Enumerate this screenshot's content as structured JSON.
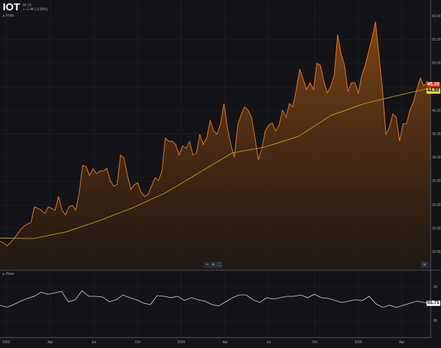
{
  "header": {
    "symbol": "IOT",
    "price": "45.10",
    "change": "-1.44 (-3.09%)",
    "plots_label": "Plots"
  },
  "lower_pane": {
    "plots_label": "Plots",
    "current_label": "51.71"
  },
  "controls": {
    "zoom_out": "−",
    "zoom_in": "+",
    "reset": "⛶",
    "scroll_forward": "»"
  },
  "colors": {
    "price": "#f07820",
    "ma": "#d8c020",
    "rsi": "#e0e0e0",
    "last_price_tag": "#c83020",
    "ma_tag": "#f0e020"
  },
  "chart_data": [
    {
      "type": "area",
      "title": "IOT",
      "ylim": [
        8,
        62
      ],
      "yticks": [
        "10.00",
        "15.00",
        "20.00",
        "25.00",
        "30.00",
        "35.00",
        "40.00",
        "45.00",
        "50.00",
        "55.00",
        "60.00"
      ],
      "last_price": "45.10",
      "ma_last": "44.80",
      "xticks": [
        "2023",
        "Apr",
        "Jul",
        "Oct",
        "2024",
        "Apr",
        "Jul",
        "Oct",
        "2025",
        "Apr"
      ],
      "price": [
        12.3,
        12.0,
        11.3,
        12.0,
        12.8,
        13.8,
        14.8,
        15.5,
        16.0,
        16.3,
        19.6,
        19.3,
        18.9,
        18.2,
        19.6,
        19.3,
        18.9,
        21.8,
        18.9,
        17.9,
        19.6,
        19.9,
        18.9,
        22.6,
        28.4,
        28.1,
        26.2,
        27.7,
        26.6,
        27.2,
        27.2,
        27.8,
        25.2,
        24.0,
        24.3,
        30.6,
        29.9,
        26.2,
        23.3,
        24.3,
        24.7,
        22.6,
        21.8,
        22.3,
        24.0,
        25.8,
        25.2,
        27.2,
        34.2,
        33.5,
        33.5,
        32.8,
        30.6,
        32.5,
        32.0,
        33.5,
        30.6,
        31.0,
        35.0,
        32.8,
        34.2,
        37.9,
        35.7,
        35.0,
        37.2,
        41.5,
        36.4,
        32.8,
        30.1,
        36.9,
        39.1,
        40.8,
        40.1,
        38.6,
        34.2,
        29.6,
        32.0,
        35.7,
        36.9,
        37.4,
        35.7,
        36.9,
        40.1,
        38.6,
        41.5,
        40.8,
        44.5,
        48.8,
        46.6,
        44.5,
        45.9,
        44.5,
        50.0,
        49.6,
        46.2,
        43.7,
        45.2,
        47.4,
        56.1,
        52.0,
        49.6,
        44.0,
        45.9,
        45.9,
        43.7,
        47.4,
        49.6,
        52.5,
        55.4,
        58.8,
        51.8,
        44.5,
        35.0,
        36.4,
        39.3,
        38.6,
        33.5,
        37.2,
        37.2,
        40.1,
        41.8,
        44.5,
        46.9,
        45.2,
        46.2,
        45.1
      ],
      "moving_average": [
        13.0,
        12.9,
        14.3,
        16.7,
        19.4,
        22.6,
        26.8,
        31.0,
        32.3,
        34.5,
        39.0,
        41.5,
        43.2,
        44.8
      ]
    },
    {
      "type": "line",
      "title": "RSI",
      "ylim": [
        5,
        95
      ],
      "yticks": [
        "20",
        "80"
      ],
      "last_value": "51.71",
      "values": [
        48.2,
        44.5,
        49.4,
        55.5,
        60.4,
        64.1,
        71.4,
        67.8,
        70.2,
        72.7,
        54.3,
        58,
        73.9,
        64.1,
        64.1,
        62.9,
        54.3,
        58,
        66.5,
        61.6,
        58,
        51.8,
        49.4,
        65.3,
        64.1,
        61.6,
        64.1,
        56.7,
        61.6,
        58,
        55.5,
        49.4,
        47,
        54.3,
        61.6,
        66.5,
        66.5,
        58,
        53.1,
        61.6,
        59.2,
        61.6,
        64.1,
        64.1,
        66.5,
        61.6,
        67.8,
        61.6,
        60.4,
        56.7,
        53.1,
        55.5,
        58,
        56.7,
        64.1,
        50.6,
        44.5,
        48.2,
        44.5,
        48.2,
        51.8,
        55.5,
        53.1,
        51.71
      ]
    }
  ]
}
